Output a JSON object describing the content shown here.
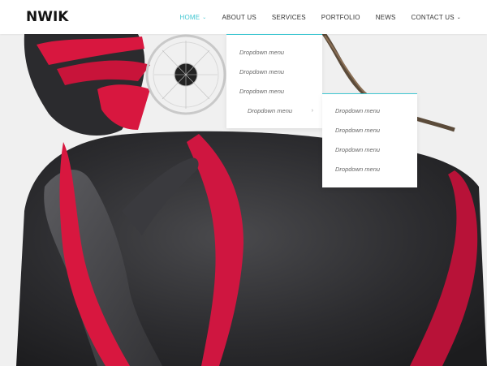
{
  "brand": {
    "logo_text": "NWIK"
  },
  "nav": {
    "items": [
      {
        "label": "HOME",
        "active": true,
        "has_caret": true
      },
      {
        "label": "ABOUT US",
        "active": false,
        "has_caret": false
      },
      {
        "label": "SERVICES",
        "active": false,
        "has_caret": false
      },
      {
        "label": "PORTFOLIO",
        "active": false,
        "has_caret": false
      },
      {
        "label": "NEWS",
        "active": false,
        "has_caret": false
      },
      {
        "label": "CONTACT US",
        "active": false,
        "has_caret": true
      }
    ],
    "caret_glyph": "⌄"
  },
  "dropdown": {
    "items": [
      {
        "label": "Dropdown menu"
      },
      {
        "label": "Dropdown menu"
      },
      {
        "label": "Dropdown menu"
      },
      {
        "label": "Dropdown menu",
        "submenu_arrow": "›"
      }
    ]
  },
  "submenu": {
    "items": [
      {
        "label": "Dropdown menu"
      },
      {
        "label": "Dropdown menu"
      },
      {
        "label": "Dropdown menu"
      },
      {
        "label": "Dropdown menu"
      }
    ]
  },
  "colors": {
    "accent": "#3fc6d1",
    "paint_red": "#d8173f",
    "skin_dark": "#2a2a2c",
    "background": "#f1f1f1"
  }
}
